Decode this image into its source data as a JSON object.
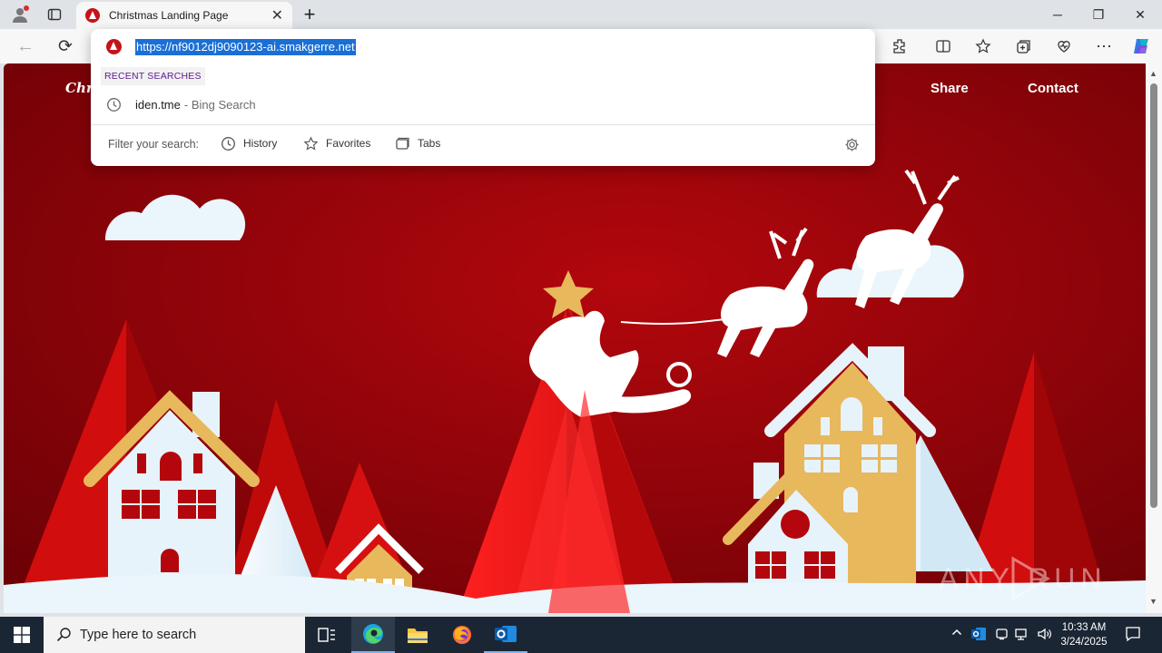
{
  "browser": {
    "tab_title": "Christmas Landing Page",
    "tab_close": "✕",
    "new_tab": "+",
    "window_controls": {
      "minimize": "─",
      "restore": "❐",
      "close": "✕"
    }
  },
  "toolbar": {
    "back": "←",
    "refresh": "⟳",
    "more": "⋯"
  },
  "omnibox": {
    "url": "https://nf9012dj9090123-ai.smakgerre.net",
    "recent_label": "RECENT SEARCHES",
    "suggestion_query": "iden.tme",
    "suggestion_source": "- Bing Search",
    "filter_label": "Filter your search:",
    "filters": [
      "History",
      "Favorites",
      "Tabs"
    ]
  },
  "page": {
    "brand": "Chri",
    "nav": [
      "Share",
      "Contact"
    ],
    "watermark": "ANY RUN"
  },
  "taskbar": {
    "search_placeholder": "Type here to search",
    "time": "10:33 AM",
    "date": "3/24/2025"
  },
  "colors": {
    "page_bg": "#8c0208",
    "tree_red": "#e11414",
    "house_white": "#e7f3fb",
    "gold": "#e8b85c",
    "taskbar": "#1b2634"
  }
}
